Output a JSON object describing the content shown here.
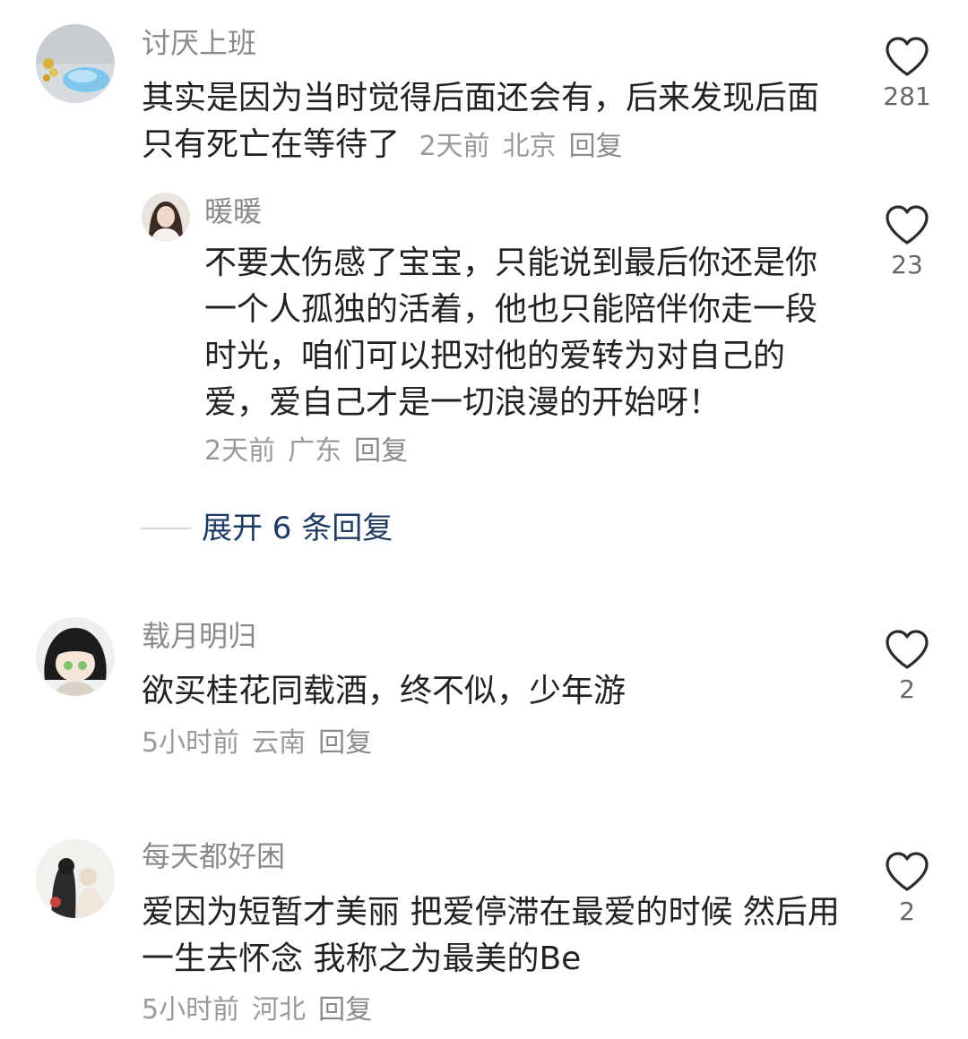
{
  "comments": [
    {
      "username": "讨厌上班",
      "text": "其实是因为当时觉得后面还会有，后来发现后面只有死亡在等待了",
      "time": "2天前",
      "location": "北京",
      "reply_label": "回复",
      "likes": "281",
      "replies": [
        {
          "username": "暖暖",
          "text": "不要太伤感了宝宝，只能说到最后你还是你一个人孤独的活着，他也只能陪伴你走一段时光，咱们可以把对他的爱转为对自己的爱，爱自己才是一切浪漫的开始呀！",
          "time": "2天前",
          "location": "广东",
          "reply_label": "回复",
          "likes": "23"
        }
      ],
      "expand_label": "展开 6 条回复"
    },
    {
      "username": "载月明归",
      "text": "欲买桂花同载酒，终不似，少年游",
      "time": "5小时前",
      "location": "云南",
      "reply_label": "回复",
      "likes": "2"
    },
    {
      "username": "每天都好困",
      "text": "爱因为短暂才美丽 把爱停滞在最爱的时候 然后用一生去怀念 我称之为最美的Be",
      "time": "5小时前",
      "location": "河北",
      "reply_label": "回复",
      "likes": "2"
    }
  ],
  "colors": {
    "username": "#8a8a8a",
    "text": "#222222",
    "meta": "#9a9a9a",
    "expand": "#1f3a63",
    "heart_stroke": "#2b2b2b"
  },
  "icons": {
    "like": "heart-outline-icon"
  }
}
